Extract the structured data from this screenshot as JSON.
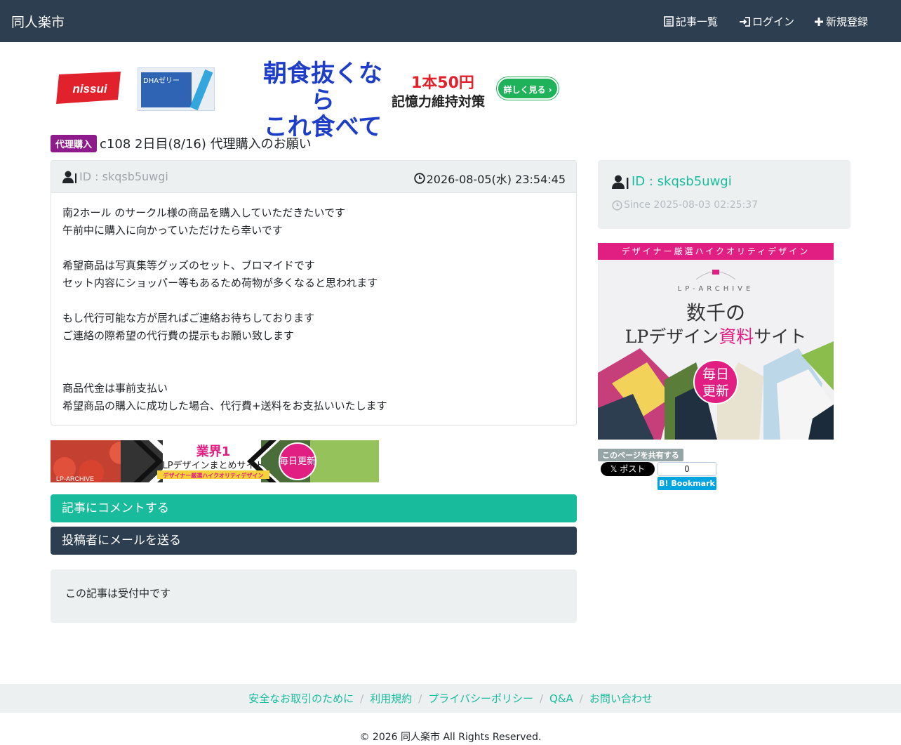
{
  "navbar": {
    "brand": "同人楽市",
    "links": [
      {
        "icon": "list-icon",
        "label": "記事一覧"
      },
      {
        "icon": "login-icon",
        "label": "ログイン"
      },
      {
        "icon": "plus-icon",
        "label": "新規登録"
      }
    ]
  },
  "top_ad": {
    "logo_text": "nissui",
    "product_text": "DHAゼリー",
    "headline_1": "朝食抜くなら",
    "headline_2": "これ食べて",
    "price": "1本50円",
    "subline": "記憶力維持対策",
    "cta": "詳しく見る ›"
  },
  "article": {
    "badge": "代理購入",
    "title": "c108 2日目(8/16) 代理購入のお願い",
    "author_id": "ID : skqsb5uwgi",
    "datetime": "2026-08-05(水) 23:54:45",
    "body_lines": [
      "南2ホール のサークル様の商品を購入していただきたいです",
      "午前中に購入に向かっていただけたら幸いです",
      "",
      "希望商品は写真集等グッズのセット、ブロマイドです",
      "セット内容にショッパー等もあるため荷物が多くなると思われます",
      "",
      "もし代行可能な方が居ればご連絡お待ちしております",
      "ご連絡の際希望の代行費の提示もお願い致します",
      "",
      "",
      "商品代金は事前支払い",
      "希望商品の購入に成功した場合、代行費+送料をお支払いいたします"
    ]
  },
  "banner2": {
    "rank": "業界1",
    "title": "LPデザインまとめサイト",
    "sub": "デザイナー厳選ハイクオリティデザイン",
    "brand": "LP-ARCHIVE",
    "circle": "毎日更新"
  },
  "buttons": {
    "comment": "記事にコメントする",
    "mail": "投稿者にメールを送る"
  },
  "status": "この記事は受付中です",
  "sidebar": {
    "user_id": "ID : skqsb5uwgi",
    "since": "Since 2025-08-03 02:25:37"
  },
  "lp_ad": {
    "top": "デザイナー厳選ハイクオリティデザイン",
    "archive": "LP-ARCHIVE",
    "line1": "数千の",
    "line2a": "LPデザイン",
    "line2b": "資料",
    "line2c": "サイト",
    "circle_1": "毎日",
    "circle_2": "更新"
  },
  "share": {
    "label": "このページを共有する",
    "x_post": "𝕏 ポスト",
    "hatena_count": "0",
    "hatena_label": "B! Bookmark"
  },
  "footer": {
    "links": [
      "安全なお取引のために",
      "利用規約",
      "プライバシーポリシー",
      "Q&A",
      "お問い合わせ"
    ],
    "separator": "/",
    "copyright": "© 2026 同人楽市 All Rights Reserved."
  },
  "colors": {
    "navbar": "#2c3e50",
    "accent": "#18bc9c",
    "badge": "#8e1b8c",
    "panel": "#ecf0f1",
    "pink": "#e11f83"
  }
}
